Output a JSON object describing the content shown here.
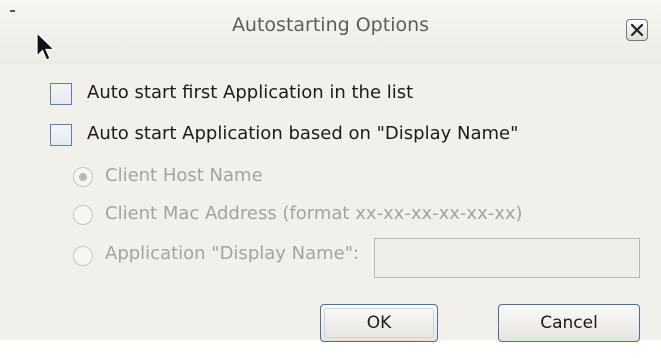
{
  "dialog": {
    "title": "Autostarting Options"
  },
  "options": {
    "auto_start_first": {
      "label": "Auto start first Application in the list",
      "checked": false
    },
    "auto_start_by_display_name": {
      "label": "Auto start Application based on \"Display Name\"",
      "checked": false
    }
  },
  "radios": [
    {
      "label": "Client Host Name",
      "selected": true,
      "enabled": false
    },
    {
      "label": "Client Mac Address (format xx-xx-xx-xx-xx-xx)",
      "selected": false,
      "enabled": false
    },
    {
      "label": "Application \"Display Name\":",
      "selected": false,
      "enabled": false
    }
  ],
  "display_name_input": {
    "value": "",
    "enabled": false
  },
  "buttons": {
    "ok": "OK",
    "cancel": "Cancel"
  },
  "icons": {
    "close": "close-icon",
    "cursor": "mouse-pointer-icon"
  }
}
